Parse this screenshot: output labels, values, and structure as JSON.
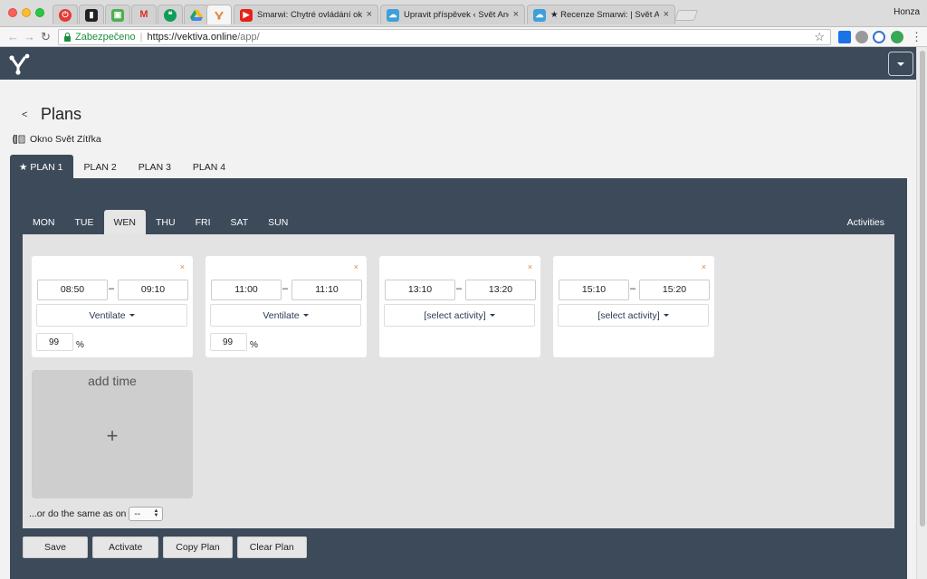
{
  "browser": {
    "tabs": [
      {
        "title": "Smarwi: Chytré ovládání oken"
      },
      {
        "title": "Upravit příspěvek ‹ Svět Android"
      },
      {
        "title": "★ Recenze Smarwi: | Svět Android"
      }
    ],
    "profile": "Honza",
    "secure_label": "Zabezpečeno",
    "url_host": "https://vektiva.online",
    "url_path": "/app/",
    "colors": {
      "secure": "#1e8e3e",
      "youtube": "#e62117",
      "gmail": "#d93025"
    }
  },
  "app": {
    "header_bg": "#3c4a5a",
    "back_label": "<",
    "page_title": "Plans",
    "device_name": "Okno Svět Zítřka",
    "plan_tabs": [
      "★ PLAN 1",
      "PLAN 2",
      "PLAN 3",
      "PLAN 4"
    ],
    "active_plan": 0,
    "day_tabs": [
      "MON",
      "TUE",
      "WEN",
      "THU",
      "FRI",
      "SAT",
      "SUN"
    ],
    "active_day": 2,
    "activities_label": "Activities",
    "remove_icon": "×",
    "slots": [
      {
        "from": "08:50",
        "to": "09:10",
        "activity": "Ventilate",
        "percent": "99"
      },
      {
        "from": "11:00",
        "to": "11:10",
        "activity": "Ventilate",
        "percent": "99"
      },
      {
        "from": "13:10",
        "to": "13:20",
        "activity": "[select activity]"
      },
      {
        "from": "15:10",
        "to": "15:20",
        "activity": "[select activity]"
      }
    ],
    "dash": "–",
    "percent_sign": "%",
    "add_time_label": "add time",
    "add_time_icon": "+",
    "same_as_label": "...or do the same as on",
    "same_as_value": "--",
    "buttons": {
      "save": "Save",
      "activate": "Activate",
      "copy": "Copy Plan",
      "clear": "Clear Plan"
    },
    "accent_orange": "#e8833a"
  }
}
